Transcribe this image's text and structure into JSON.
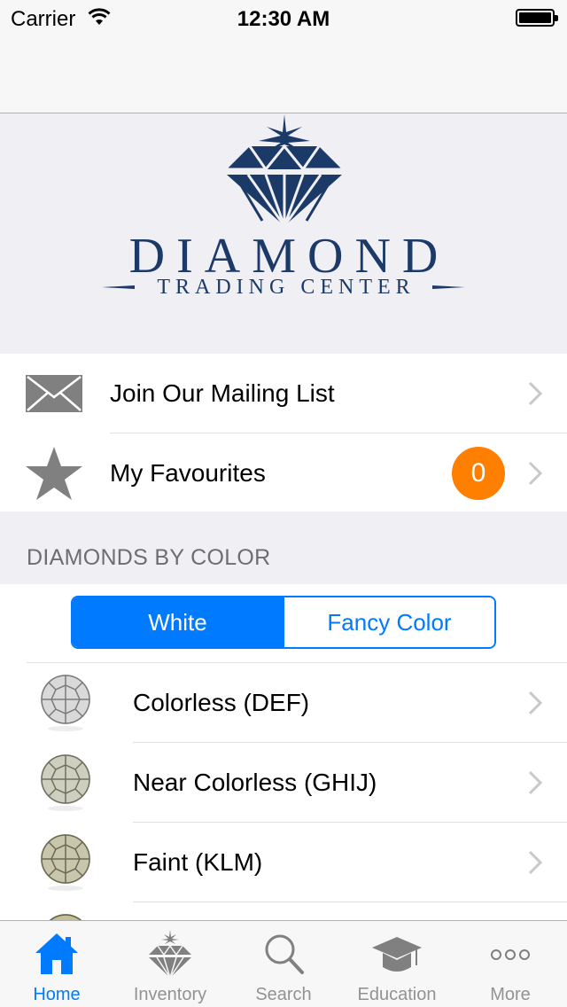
{
  "status_bar": {
    "carrier": "Carrier",
    "time": "12:30 AM"
  },
  "logo": {
    "title": "DIAMOND",
    "subtitle": "TRADING CENTER",
    "color": "#1c3a68"
  },
  "menu": [
    {
      "label": "Join Our Mailing List",
      "icon": "envelope-icon"
    },
    {
      "label": "My Favourites",
      "icon": "star-icon",
      "badge": "0"
    }
  ],
  "section_header": "DIAMONDS BY COLOR",
  "segmented": {
    "options": [
      "White",
      "Fancy Color"
    ],
    "selected": "White"
  },
  "color_list": [
    {
      "label": "Colorless (DEF)",
      "tint": "#d9d9d9"
    },
    {
      "label": "Near Colorless (GHIJ)",
      "tint": "#cfcfbf"
    },
    {
      "label": "Faint (KLM)",
      "tint": "#c8c6ac"
    },
    {
      "label": "",
      "tint": "#c3bf98"
    }
  ],
  "tabs": [
    {
      "label": "Home",
      "icon": "home-icon",
      "active": true
    },
    {
      "label": "Inventory",
      "icon": "diamond-icon",
      "active": false
    },
    {
      "label": "Search",
      "icon": "search-icon",
      "active": false
    },
    {
      "label": "Education",
      "icon": "graduation-cap-icon",
      "active": false
    },
    {
      "label": "More",
      "icon": "more-icon",
      "active": false
    }
  ],
  "colors": {
    "accent": "#007aff",
    "badge": "#ff7f00",
    "inactive_tab": "#929292"
  }
}
